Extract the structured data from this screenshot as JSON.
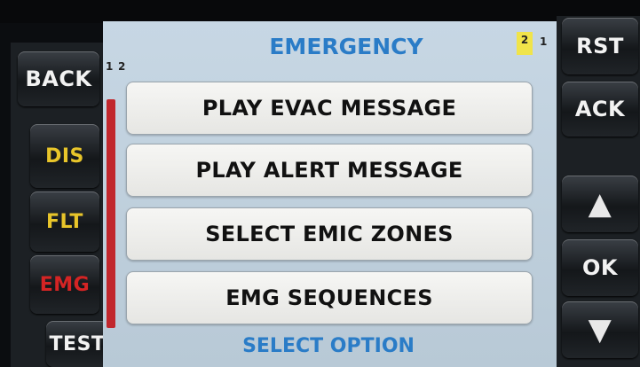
{
  "title": "EMERGENCY",
  "pager": {
    "left": [
      "1",
      "2"
    ],
    "current": "2",
    "other": "1"
  },
  "left_keys": [
    "BACK",
    "DIS",
    "FLT",
    "EMG",
    "TEST"
  ],
  "right_keys": {
    "rst": "RST",
    "ack": "ACK",
    "up": "▲",
    "ok": "OK",
    "down": "▼"
  },
  "menu": [
    "PLAY EVAC MESSAGE",
    "PLAY ALERT MESSAGE",
    "SELECT EMIC ZONES",
    "EMG SEQUENCES"
  ],
  "status": "SELECT OPTION",
  "colors": {
    "title": "#2a7cc7",
    "dis": "#e8c52a",
    "flt": "#e8c52a",
    "emg": "#d42424",
    "scrollbar": "#c1272d",
    "page_badge": "#f0e44a"
  }
}
